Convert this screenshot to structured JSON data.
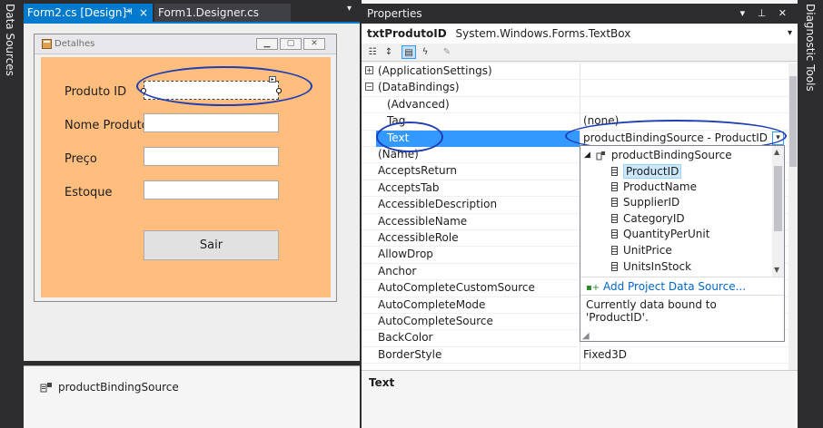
{
  "side_tabs": {
    "left": "Data Sources",
    "right": "Diagnostic Tools"
  },
  "doc_tabs": [
    {
      "label": "Form2.cs [Design]*"
    },
    {
      "label": "Form1.Designer.cs"
    }
  ],
  "form": {
    "title": "Detalhes",
    "labels": {
      "produto": "Produto ID",
      "nome": "Nome Produto",
      "preco": "Preço",
      "estoque": "Estoque"
    },
    "button_label": "Sair",
    "background_color": "#ffbd7e"
  },
  "tray": {
    "component": "productBindingSource"
  },
  "properties": {
    "panel_title": "Properties",
    "object_name": "txtProdutoID",
    "object_type": "System.Windows.Forms.TextBox",
    "rows": [
      {
        "name": "(ApplicationSettings)",
        "value": "",
        "expander": "+"
      },
      {
        "name": "(DataBindings)",
        "value": "",
        "expander": "−"
      },
      {
        "name": "(Advanced)",
        "value": ""
      },
      {
        "name": "Tag",
        "value": "(none)"
      },
      {
        "name": "Text",
        "value": "productBindingSource - ProductID"
      },
      {
        "name": "(Name)",
        "value": ""
      },
      {
        "name": "AcceptsReturn",
        "value": ""
      },
      {
        "name": "AcceptsTab",
        "value": ""
      },
      {
        "name": "AccessibleDescription",
        "value": ""
      },
      {
        "name": "AccessibleName",
        "value": ""
      },
      {
        "name": "AccessibleRole",
        "value": ""
      },
      {
        "name": "AllowDrop",
        "value": ""
      },
      {
        "name": "Anchor",
        "value": ""
      },
      {
        "name": "AutoCompleteCustomSource",
        "value": ""
      },
      {
        "name": "AutoCompleteMode",
        "value": ""
      },
      {
        "name": "AutoCompleteSource",
        "value": ""
      },
      {
        "name": "BackColor",
        "value": ""
      },
      {
        "name": "BorderStyle",
        "value": "Fixed3D"
      }
    ],
    "selected_property": "Text",
    "description_title": "Text"
  },
  "binding_dropdown": {
    "source": "productBindingSource",
    "fields": [
      "ProductID",
      "ProductName",
      "SupplierID",
      "CategoryID",
      "QuantityPerUnit",
      "UnitPrice",
      "UnitsInStock"
    ],
    "selected_field": "ProductID",
    "add_source_label": "Add Project Data Source...",
    "info": "Currently data bound to 'ProductID'."
  },
  "colors": {
    "accent": "#007acc",
    "selection": "#3399ff",
    "annotation": "#1e3eb4"
  }
}
